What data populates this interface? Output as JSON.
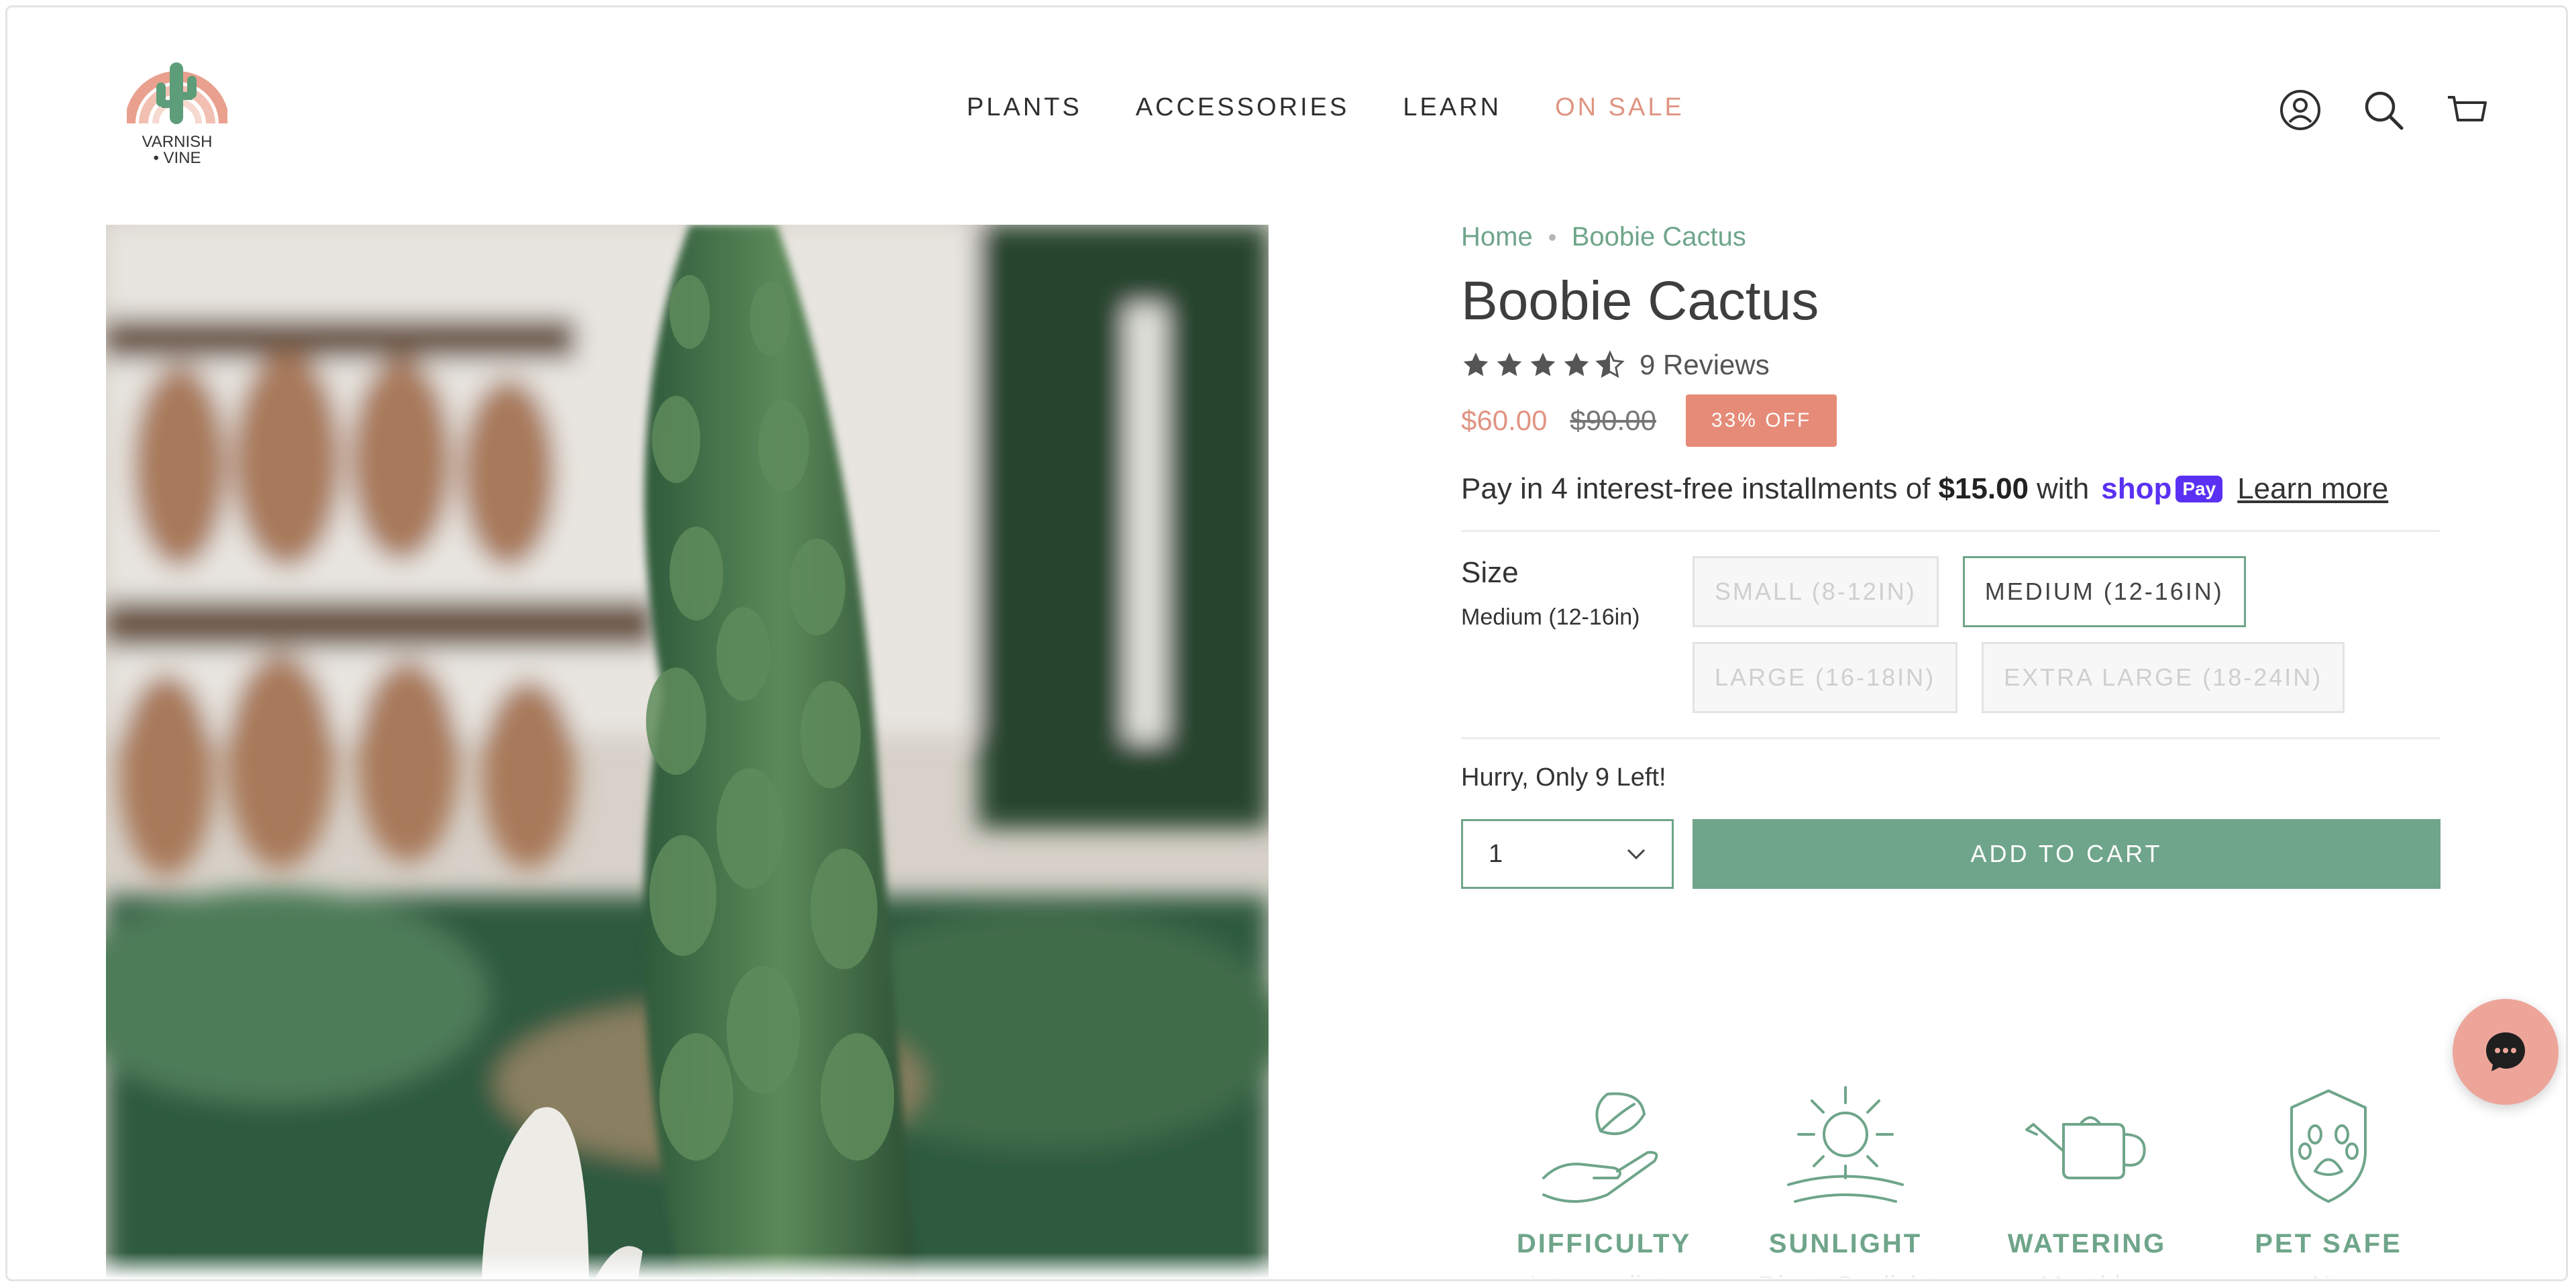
{
  "brand": {
    "name_line1": "VARNISH",
    "name_line2": "• VINE"
  },
  "nav": {
    "items": [
      "PLANTS",
      "ACCESSORIES",
      "LEARN",
      "ON SALE"
    ]
  },
  "icons": {
    "account": "account-icon",
    "search": "search-icon",
    "cart": "cart-icon",
    "chat": "chat-icon"
  },
  "breadcrumb": {
    "home": "Home",
    "current": "Boobie Cactus"
  },
  "product": {
    "title": "Boobie Cactus",
    "rating": 4.5,
    "reviews": "9 Reviews",
    "price": "$60.00",
    "compare_price": "$90.00",
    "badge": "33% OFF"
  },
  "shop_pay": {
    "text_before": "Pay in 4 interest-free installments of",
    "amount": "$15.00",
    "text_after": "with",
    "brand": "shop",
    "brand_pay": "Pay",
    "learn_more": "Learn more"
  },
  "size": {
    "label": "Size",
    "selected": "Medium (12-16in)",
    "options": [
      "SMALL (8-12IN)",
      "MEDIUM (12-16IN)",
      "LARGE (16-18IN)",
      "EXTRA LARGE (18-24IN)"
    ]
  },
  "stock": {
    "message": "Hurry, Only 9 Left!"
  },
  "purchase": {
    "quantity": "1",
    "add_to_cart": "ADD TO CART"
  },
  "features": [
    {
      "heading": "DIFFICULTY",
      "value": "Intermediate"
    },
    {
      "heading": "SUNLIGHT",
      "value": "Direct Sunlight"
    },
    {
      "heading": "WATERING",
      "value": "Monthly"
    },
    {
      "heading": "PET SAFE",
      "value": "No"
    }
  ],
  "colors": {
    "accent": "#6fa58a",
    "sale": "#e09482",
    "badge": "#e58b78",
    "chat": "#eda59a",
    "shop_pay": "#5a31f4"
  }
}
